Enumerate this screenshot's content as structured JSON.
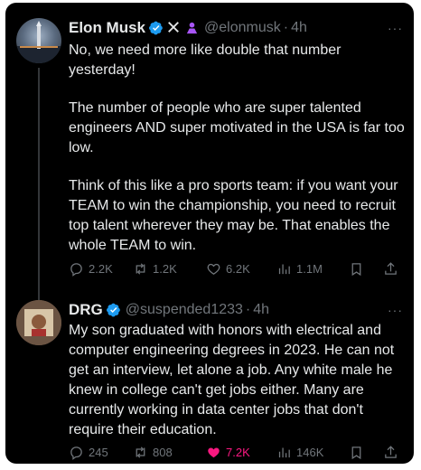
{
  "tweets": [
    {
      "author": {
        "name": "Elon Musk",
        "handle": "@elonmusk",
        "time": "4h"
      },
      "paragraphs": [
        "No, we need more like double that number yesterday!",
        "The number of people who are super talented engineers AND super motivated in the USA is far too low.",
        "Think of this like a pro sports team: if you want your TEAM to win the championship, you need to recruit top talent wherever they may be. That enables the whole TEAM to win."
      ],
      "stats": {
        "replies": "2.2K",
        "reposts": "1.2K",
        "likes": "6.2K",
        "views": "1.1M"
      }
    },
    {
      "author": {
        "name": "DRG",
        "handle": "@suspended1233",
        "time": "4h"
      },
      "paragraphs": [
        "My son graduated with honors with electrical and computer engineering degrees in 2023. He can not get an interview, let alone a job.  Any white male he knew in college can't get jobs either. Many are currently working in data center jobs that don't require their education."
      ],
      "stats": {
        "replies": "245",
        "reposts": "808",
        "likes": "7.2K",
        "views": "146K"
      }
    }
  ],
  "ui": {
    "separator": "·",
    "more_glyph": "···"
  },
  "colors": {
    "background": "#000000",
    "text": "#e7e9ea",
    "muted": "#71767b",
    "verified": "#1d9bf0",
    "like_active": "#f91880",
    "accent_purple": "#a855f7"
  },
  "icons": [
    "verified-badge-icon",
    "x-logo-icon",
    "affiliate-icon",
    "reply-icon",
    "repost-icon",
    "like-icon",
    "views-icon",
    "bookmark-icon",
    "share-icon",
    "more-icon"
  ]
}
